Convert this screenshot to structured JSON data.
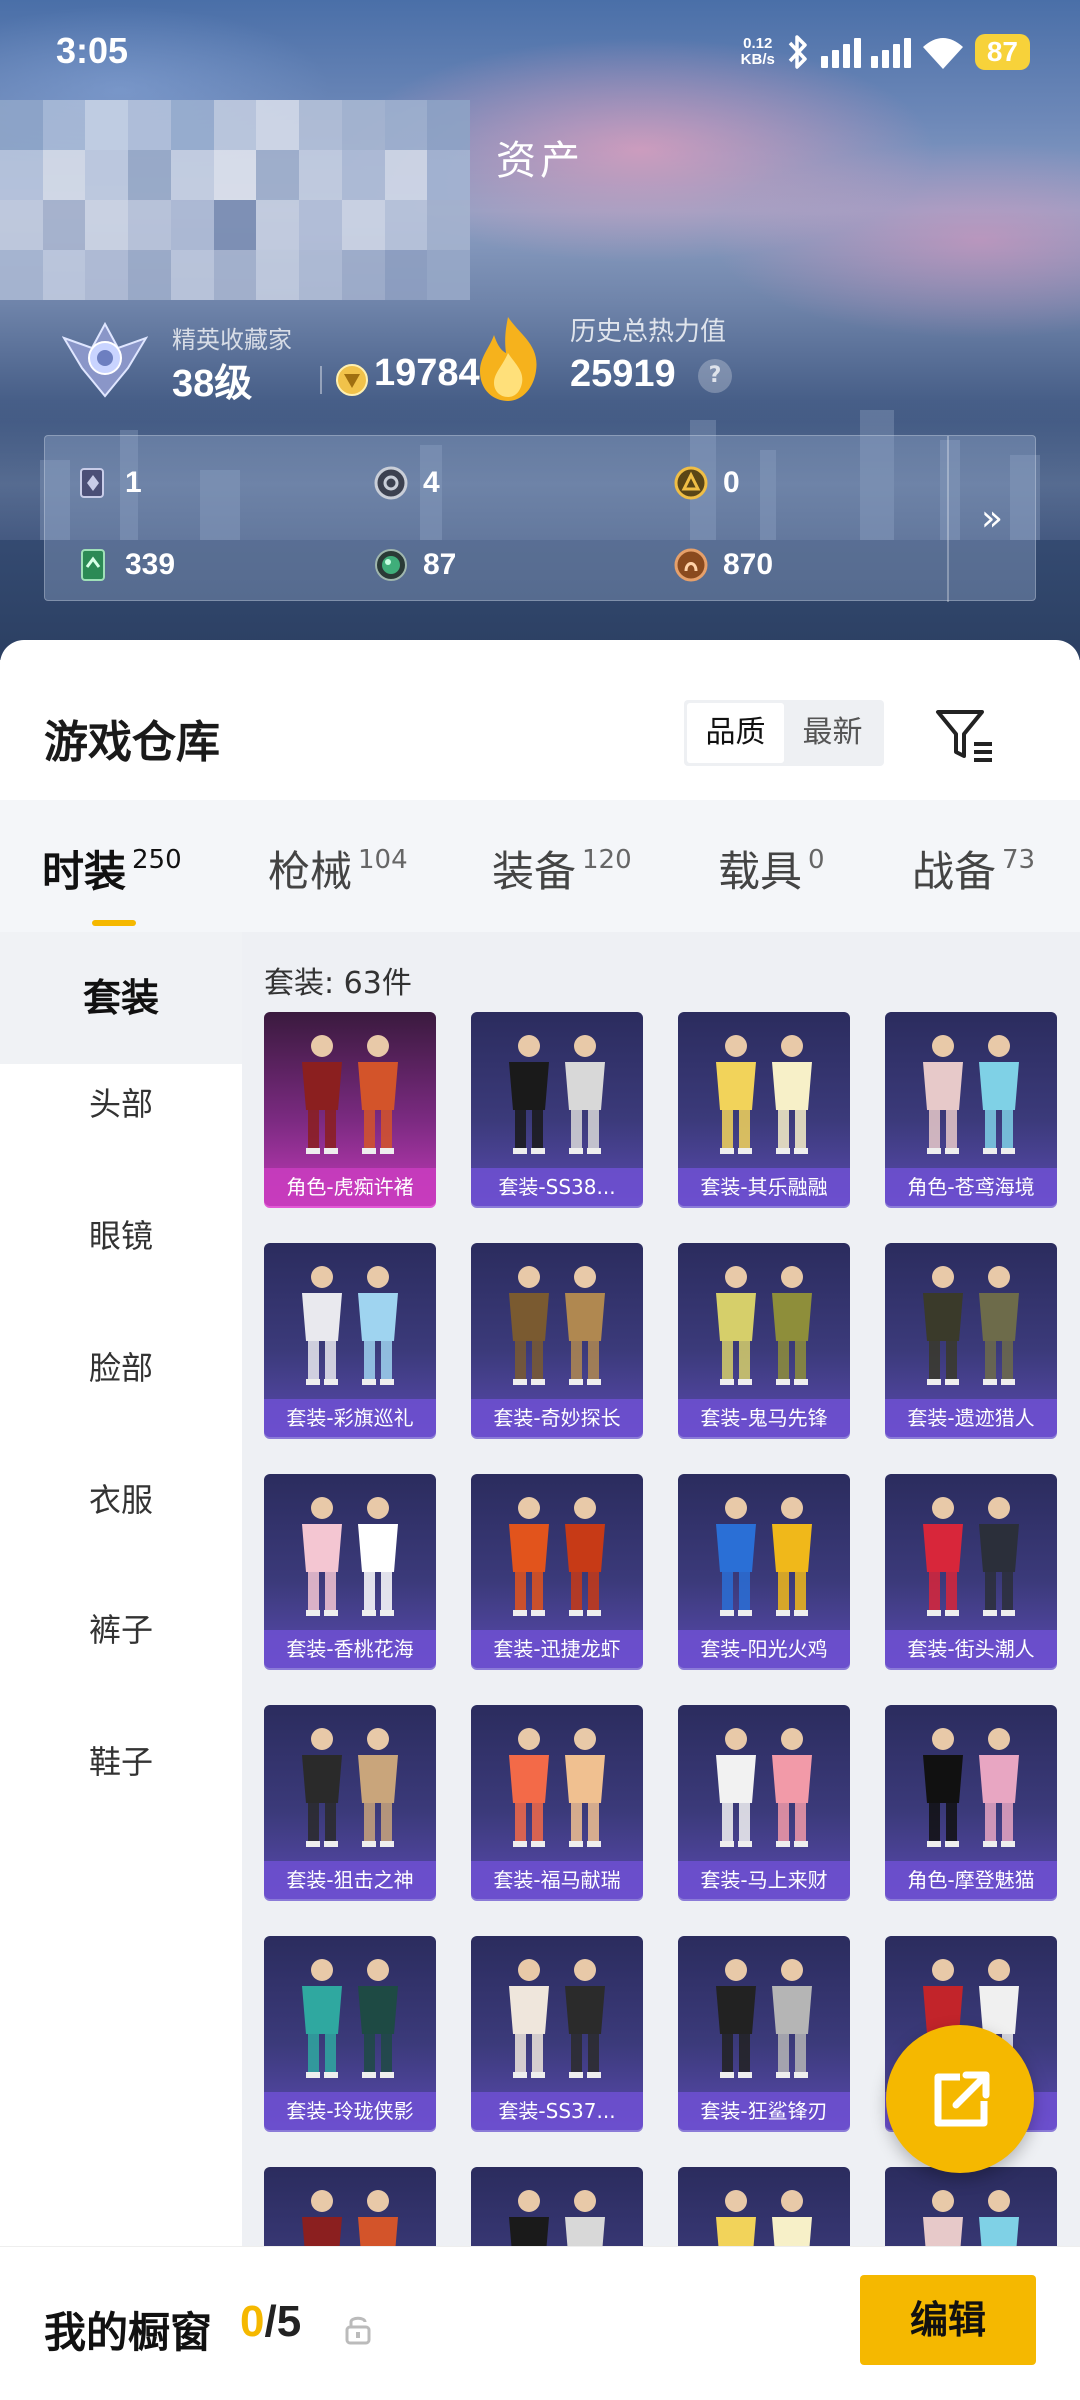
{
  "status_bar": {
    "time": "3:05",
    "net_speed_value": "0.12",
    "net_speed_unit": "KB/s",
    "battery": "87"
  },
  "header": {
    "title": "资产",
    "rank_title": "精英收藏家",
    "rank_level": "38级",
    "coins": "19784",
    "heat_title": "历史总热力值",
    "heat_value": "25919",
    "help_symbol": "?"
  },
  "currencies": [
    {
      "icon": "card-icon",
      "value": "1"
    },
    {
      "icon": "silver-coin-icon",
      "value": "4"
    },
    {
      "icon": "gold-coin-icon",
      "value": "0"
    },
    {
      "icon": "green-ticket-icon",
      "value": "339"
    },
    {
      "icon": "green-orb-icon",
      "value": "87"
    },
    {
      "icon": "bronze-coin-icon",
      "value": "870"
    }
  ],
  "currency_more_symbol": "»",
  "warehouse": {
    "title": "游戏仓库",
    "sort_options": [
      "品质",
      "最新"
    ],
    "active_sort": "品质"
  },
  "tabs": [
    {
      "label": "时装",
      "count": "250"
    },
    {
      "label": "枪械",
      "count": "104"
    },
    {
      "label": "装备",
      "count": "120"
    },
    {
      "label": "载具",
      "count": "0"
    },
    {
      "label": "战备",
      "count": "73"
    }
  ],
  "active_tab": "时装",
  "side_nav": [
    "套装",
    "头部",
    "眼镜",
    "脸部",
    "衣服",
    "裤子",
    "鞋子"
  ],
  "active_side": "套装",
  "grid_count": "套装: 63件",
  "items": [
    {
      "label": "角色-虎痴许褚",
      "rarity": "gold"
    },
    {
      "label": "套装-SS38...",
      "rarity": "purple"
    },
    {
      "label": "套装-其乐融融",
      "rarity": "purple"
    },
    {
      "label": "角色-苍鸢海境",
      "rarity": "purple"
    },
    {
      "label": "套装-彩旗巡礼",
      "rarity": "purple"
    },
    {
      "label": "套装-奇妙探长",
      "rarity": "purple"
    },
    {
      "label": "套装-鬼马先锋",
      "rarity": "purple"
    },
    {
      "label": "套装-遗迹猎人",
      "rarity": "purple"
    },
    {
      "label": "套装-香桃花海",
      "rarity": "purple"
    },
    {
      "label": "套装-迅捷龙虾",
      "rarity": "purple"
    },
    {
      "label": "套装-阳光火鸡",
      "rarity": "purple"
    },
    {
      "label": "套装-街头潮人",
      "rarity": "purple"
    },
    {
      "label": "套装-狙击之神",
      "rarity": "purple"
    },
    {
      "label": "套装-福马献瑞",
      "rarity": "purple"
    },
    {
      "label": "套装-马上来财",
      "rarity": "purple"
    },
    {
      "label": "角色-摩登魅猫",
      "rarity": "purple"
    },
    {
      "label": "套装-玲珑侠影",
      "rarity": "purple"
    },
    {
      "label": "套装-SS37...",
      "rarity": "purple"
    },
    {
      "label": "套装-狂鲨锋刃",
      "rarity": "purple"
    },
    {
      "label": "昌",
      "rarity": "purple"
    }
  ],
  "bottom_bar": {
    "showcase_label": "我的橱窗",
    "showcase_current": "0",
    "showcase_sep": "/",
    "showcase_total": "5",
    "edit_label": "编辑"
  }
}
